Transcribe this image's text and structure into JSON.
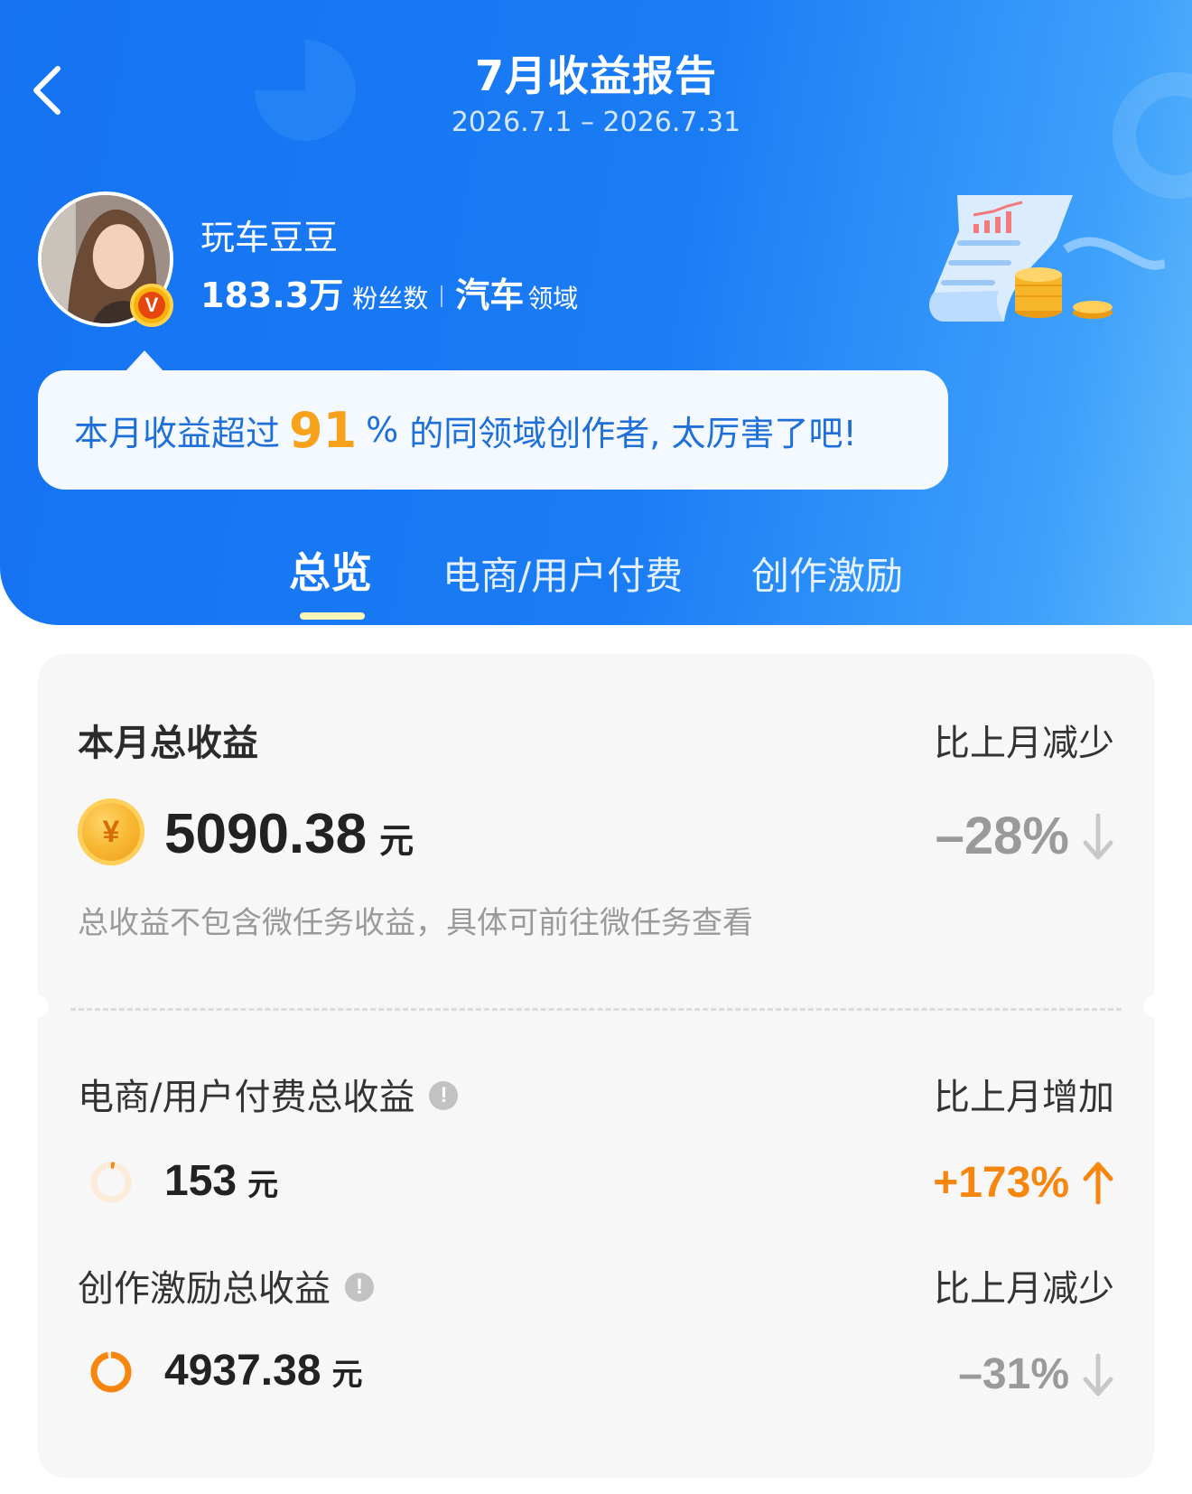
{
  "header": {
    "title": "7月收益报告",
    "date_range": "2026.7.1 – 2026.7.31"
  },
  "profile": {
    "username": "玩车豆豆",
    "followers": "183.3万",
    "followers_label": "粉丝数",
    "field": "汽车",
    "field_label": "领域",
    "badge": "V"
  },
  "tip": {
    "prefix": "本月收益超过",
    "percent": "91",
    "percent_sign": "%",
    "suffix": "的同领域创作者, 太厉害了吧!"
  },
  "tabs": [
    {
      "label": "总览",
      "active": true
    },
    {
      "label": "电商/用户付费",
      "active": false
    },
    {
      "label": "创作激励",
      "active": false
    }
  ],
  "summary": {
    "label": "本月总收益",
    "compare_label": "比上月减少",
    "coin_symbol": "¥",
    "amount": "5090.38",
    "unit": "元",
    "change": "–28%",
    "change_direction": "down",
    "note": "总收益不包含微任务收益，具体可前往微任务查看"
  },
  "breakdown": [
    {
      "label": "电商/用户付费总收益",
      "compare_label": "比上月增加",
      "amount": "153",
      "unit": "元",
      "change": "+173%",
      "change_direction": "up",
      "share": 0.03
    },
    {
      "label": "创作激励总收益",
      "compare_label": "比上月减少",
      "amount": "4937.38",
      "unit": "元",
      "change": "–31%",
      "change_direction": "down",
      "share": 0.97
    }
  ],
  "colors": {
    "header_blue": "#1573f2",
    "accent_orange": "#f7860f",
    "percent_yellow": "#f7a21a",
    "muted_gray": "#9a9a9a"
  }
}
